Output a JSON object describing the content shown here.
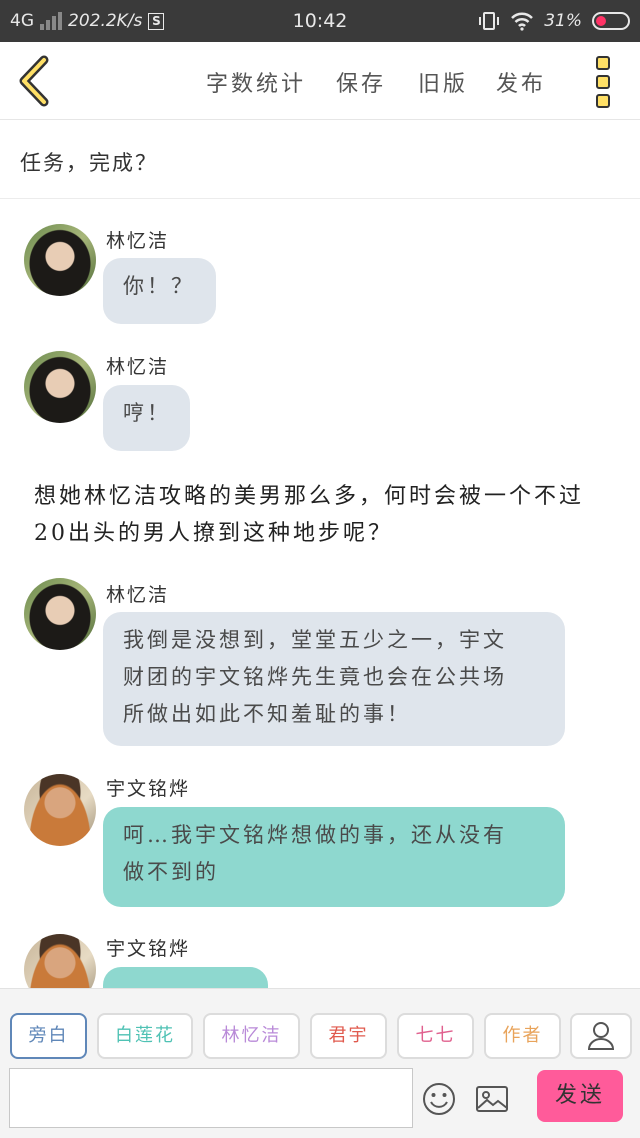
{
  "status_bar": {
    "network": "4G",
    "speed": "202.2K/s",
    "s_badge": "S",
    "time": "10:42",
    "battery": "31%"
  },
  "toolbar": {
    "word_count": "字数统计",
    "save": "保存",
    "old_version": "旧版",
    "publish": "发布",
    "back_icon": "chevron-left-icon",
    "more_icon": "more-vertical-icon"
  },
  "chapter_title": "任务，完成？",
  "messages": [
    {
      "sender": "林忆洁",
      "text": "你！？",
      "style": "grey"
    },
    {
      "sender": "林忆洁",
      "text": "哼！",
      "style": "grey"
    },
    {
      "narration": "想她林忆洁攻略的美男那么多，何时会被一个不过20出头的男人撩到这种地步呢？"
    },
    {
      "sender": "林忆洁",
      "lines": [
        "我倒是没想到，堂堂五少之一，宇文",
        "财团的宇文铭烨先生竟也会在公共场",
        "所做出如此不知羞耻的事！"
      ],
      "style": "grey"
    },
    {
      "sender": "宇文铭烨",
      "lines": [
        "呵…我宇文铭烨想做的事，还从没有",
        "做不到的"
      ],
      "style": "teal"
    },
    {
      "sender": "宇文铭烨",
      "text": "",
      "style": "teal"
    }
  ],
  "characters": [
    {
      "label": "旁白",
      "color": "#5f87b8"
    },
    {
      "label": "白莲花",
      "color": "#4fc2b4"
    },
    {
      "label": "林忆洁",
      "color": "#b98ad8"
    },
    {
      "label": "君宇",
      "color": "#e05a4e"
    },
    {
      "label": "七七",
      "color": "#e0608e"
    },
    {
      "label": "作者",
      "color": "#e8a35a"
    }
  ],
  "composer": {
    "input_value": "",
    "send": "发送"
  },
  "colors": {
    "grey_bubble": "#dfe5ec",
    "teal_bubble": "#8ed8cf",
    "send_button": "#ff5b9a",
    "accent_yellow": "#ffe066"
  }
}
